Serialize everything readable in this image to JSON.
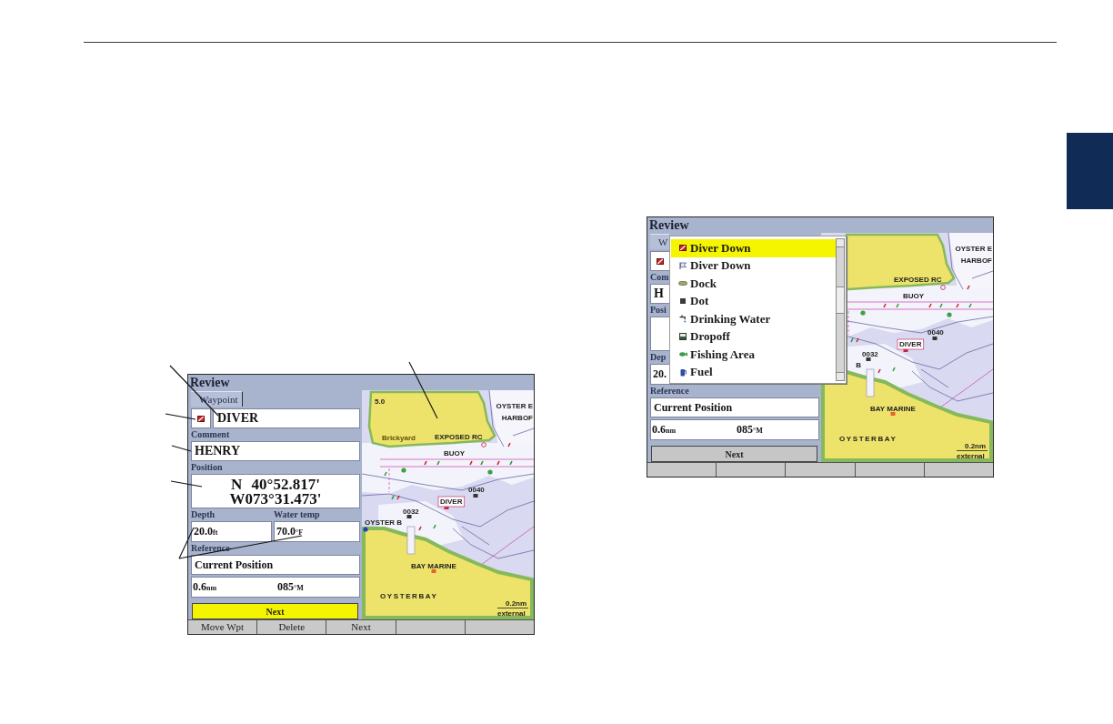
{
  "screens": [
    {
      "title": "Review",
      "tab": {
        "label": "Waypoint",
        "selected": true
      },
      "name": "DIVER",
      "comment_label": "Comment",
      "comment": "HENRY",
      "position_label": "Position",
      "position": [
        "N 40°52.817'",
        "W073°31.473'"
      ],
      "depth_label": "Depth",
      "water_temp_label": "Water temp",
      "depth": {
        "value": "20.0",
        "unit": "ft"
      },
      "water_temp": {
        "value": "70.0",
        "unit": "°F"
      },
      "reference_label": "Reference",
      "reference": "Current Position",
      "distance": {
        "value": "0.6",
        "unit": "nm"
      },
      "bearing": {
        "value": "085",
        "unit": "°M"
      },
      "next_button": {
        "label": "Next",
        "selected": true
      },
      "map": {
        "labels": [
          "OYSTER E",
          "HARBOF",
          "5.0",
          "Brickyard",
          "EXPOSED RC",
          "BUOY",
          "DIVER",
          "0040",
          "0032",
          "OYSTER B",
          "BAY MARINE",
          "OYSTERBAY",
          "0.2nm",
          "external"
        ]
      },
      "softkeys": [
        "Move Wpt",
        "Delete",
        "Next"
      ]
    },
    {
      "title": "Review",
      "tab": {
        "label": "W",
        "selected": true
      },
      "comment_label": "Com",
      "comment": "H",
      "position_label": "Posi",
      "depth_label": "Dep",
      "depth": {
        "value": "20."
      },
      "reference_label": "Reference",
      "reference": "Current Position",
      "distance": {
        "value": "0.6",
        "unit": "nm"
      },
      "bearing": {
        "value": "085",
        "unit": "°M"
      },
      "next_button": {
        "label": "Next",
        "selected": false
      },
      "map": {
        "labels": [
          "OYSTER E",
          "HARBOF",
          "EXPOSED RC",
          "BUOY",
          "DIVER",
          "0040",
          "0032",
          "B",
          "BAY MARINE",
          "OYSTERBAY",
          "0.2nm",
          "external"
        ]
      },
      "symbol_menu": {
        "items": [
          {
            "label": "Diver Down",
            "selected": true
          },
          {
            "label": "Diver Down",
            "selected": false
          },
          {
            "label": "Dock",
            "selected": false
          },
          {
            "label": "Dot",
            "selected": false
          },
          {
            "label": "Drinking Water",
            "selected": false
          },
          {
            "label": "Dropoff",
            "selected": false
          },
          {
            "label": "Fishing Area",
            "selected": false
          },
          {
            "label": "Fuel",
            "selected": false
          }
        ]
      }
    }
  ]
}
